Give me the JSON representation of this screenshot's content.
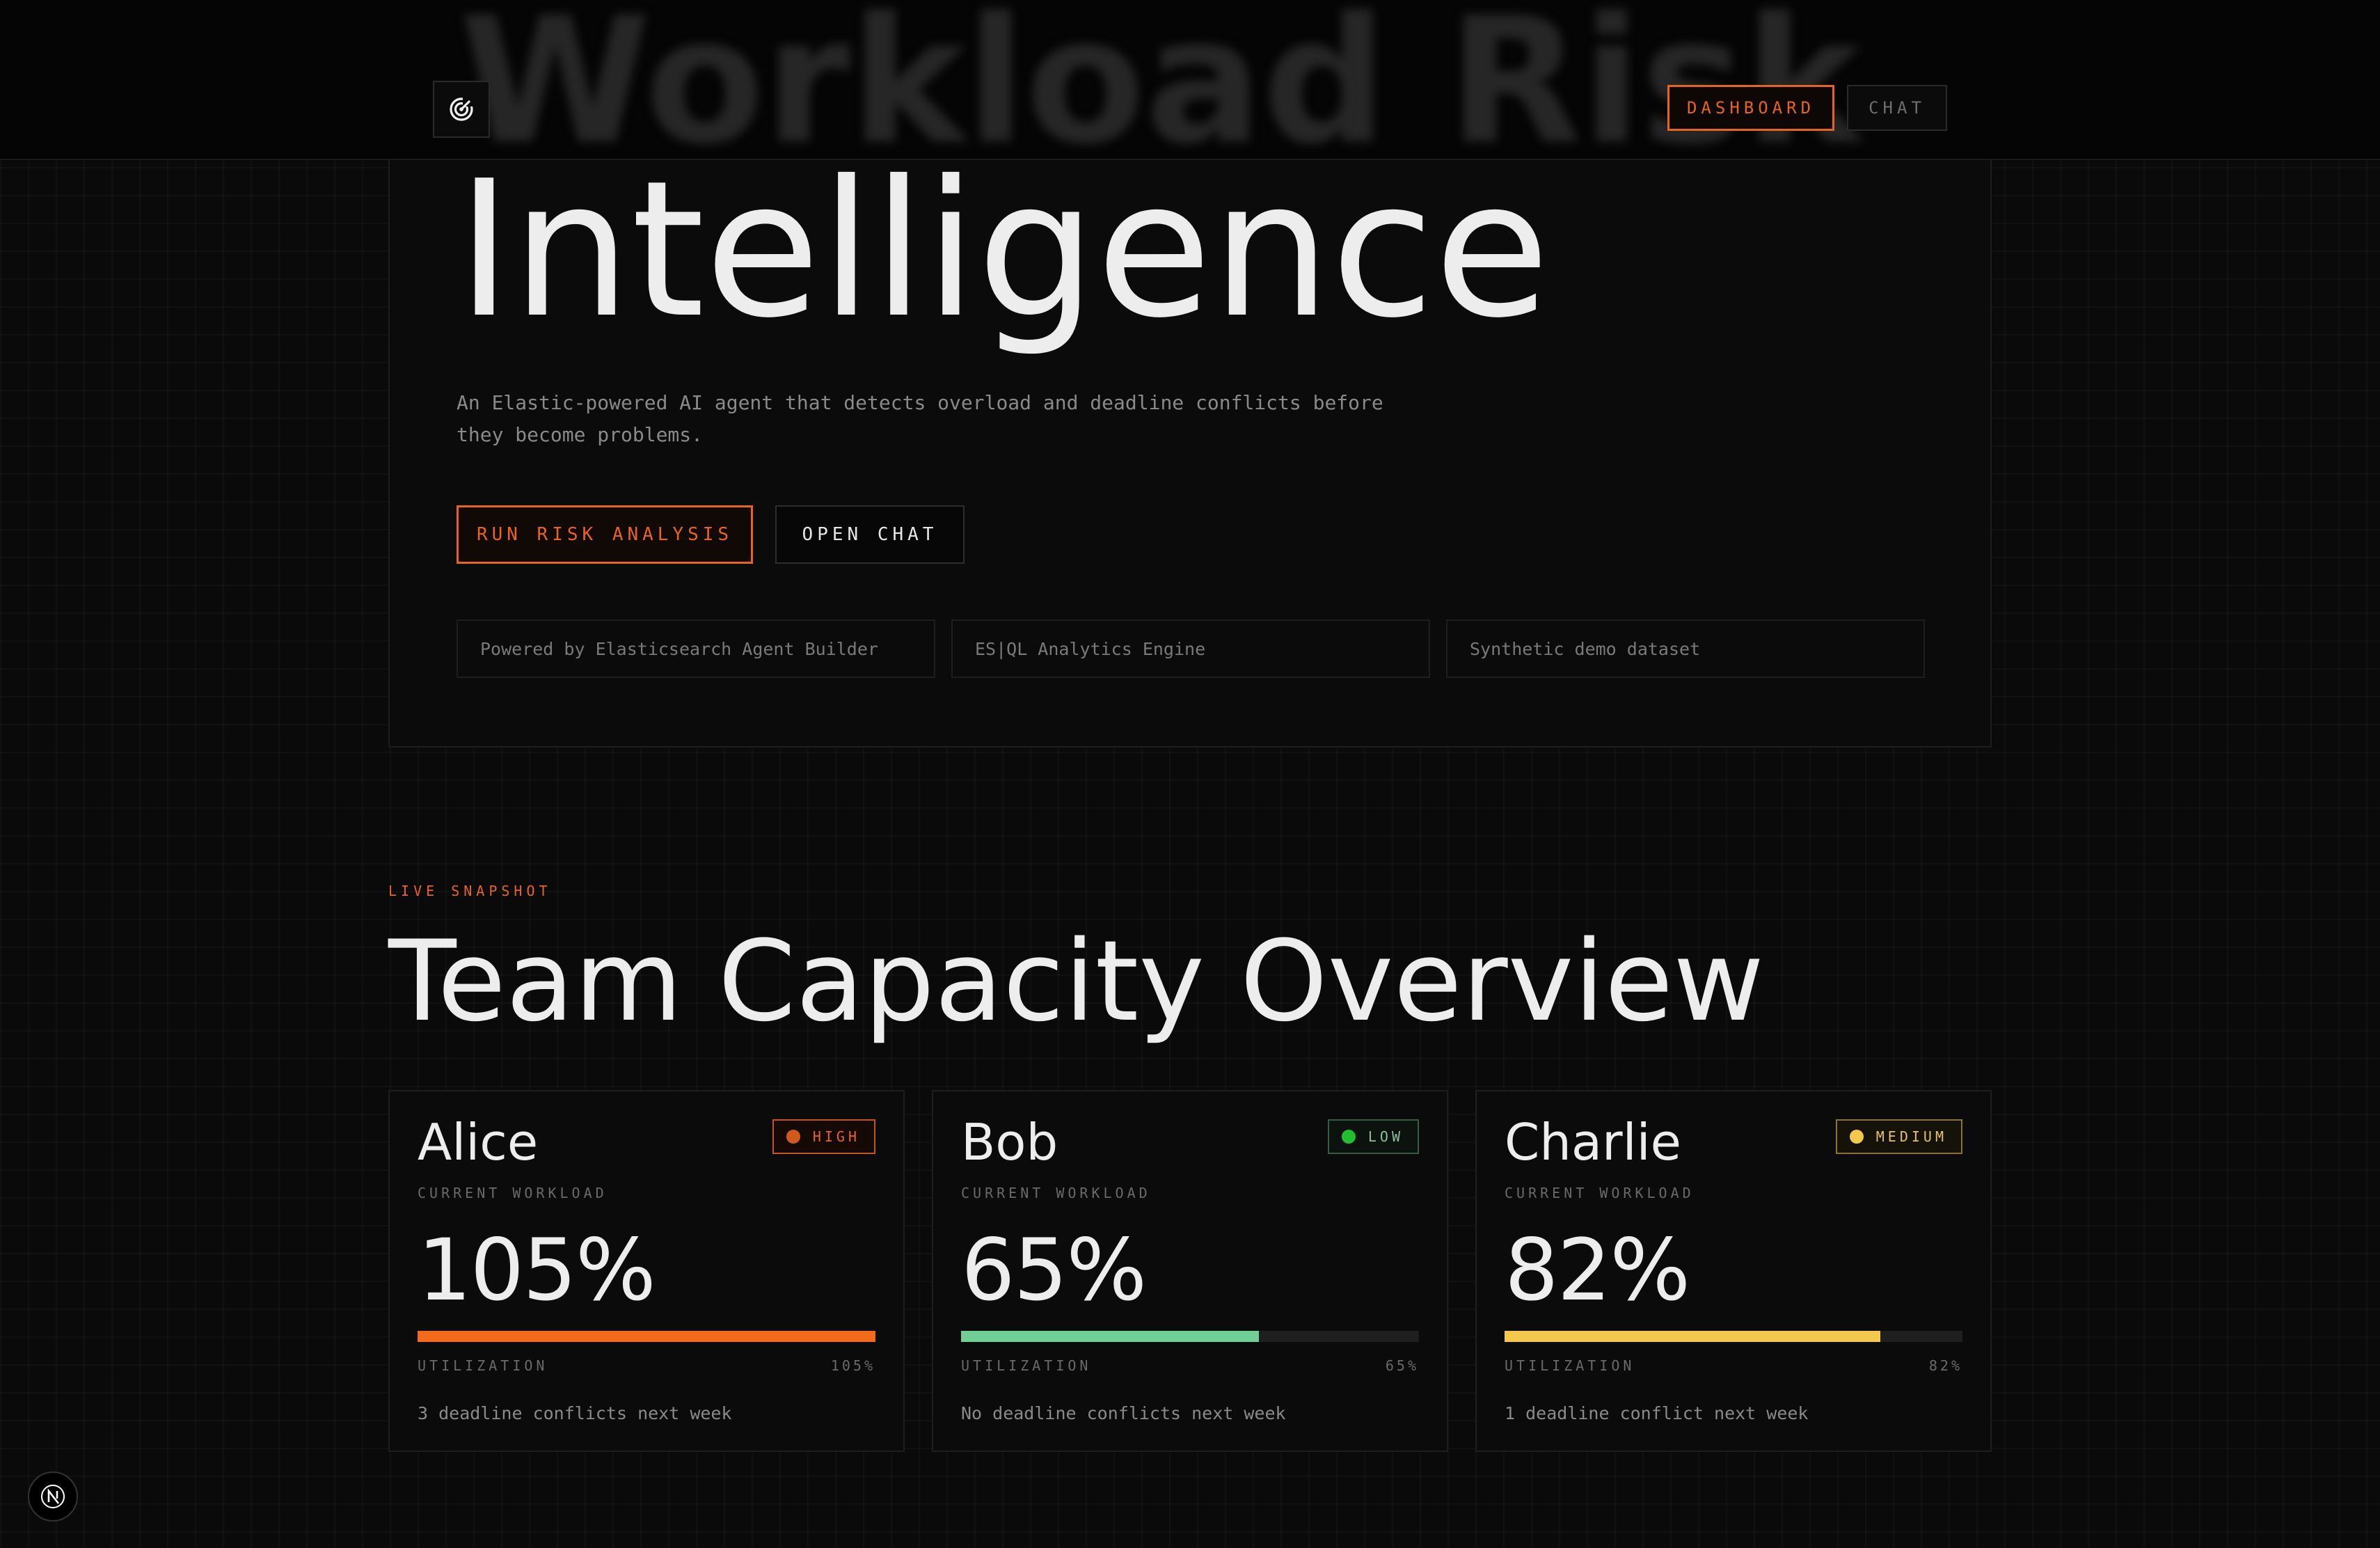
{
  "header": {
    "ghost_title": "Workload Risk",
    "logo_icon": "radar-target-icon",
    "nav": [
      {
        "label": "DASHBOARD",
        "active": true
      },
      {
        "label": "CHAT",
        "active": false
      }
    ]
  },
  "hero": {
    "title": "Intelligence",
    "description": "An Elastic-powered AI agent that detects overload and deadline conflicts before they become problems.",
    "primary_cta": "RUN RISK ANALYSIS",
    "secondary_cta": "OPEN CHAT",
    "pills": [
      "Powered by Elasticsearch Agent Builder",
      "ES|QL Analytics Engine",
      "Synthetic demo dataset"
    ]
  },
  "section": {
    "eyebrow": "LIVE SNAPSHOT",
    "title": "Team Capacity Overview"
  },
  "colors": {
    "accent": "#e8641c",
    "high": "#f26a1b",
    "low": "#6fcf97",
    "medium": "#f2c94c"
  },
  "cards": [
    {
      "name": "Alice",
      "badge": "HIGH",
      "subtitle": "CURRENT WORKLOAD",
      "percent_label": "105%",
      "utilization": 1.0,
      "utilization_label": "UTILIZATION",
      "utilization_value": "105%",
      "note": "3 deadline conflicts next week"
    },
    {
      "name": "Bob",
      "badge": "LOW",
      "subtitle": "CURRENT WORKLOAD",
      "percent_label": "65%",
      "utilization": 0.65,
      "utilization_label": "UTILIZATION",
      "utilization_value": "65%",
      "note": "No deadline conflicts next week"
    },
    {
      "name": "Charlie",
      "badge": "MEDIUM",
      "subtitle": "CURRENT WORKLOAD",
      "percent_label": "82%",
      "utilization": 0.82,
      "utilization_label": "UTILIZATION",
      "utilization_value": "82%",
      "note": "1 deadline conflict next week"
    }
  ],
  "dev_indicator": {
    "label": "N"
  }
}
